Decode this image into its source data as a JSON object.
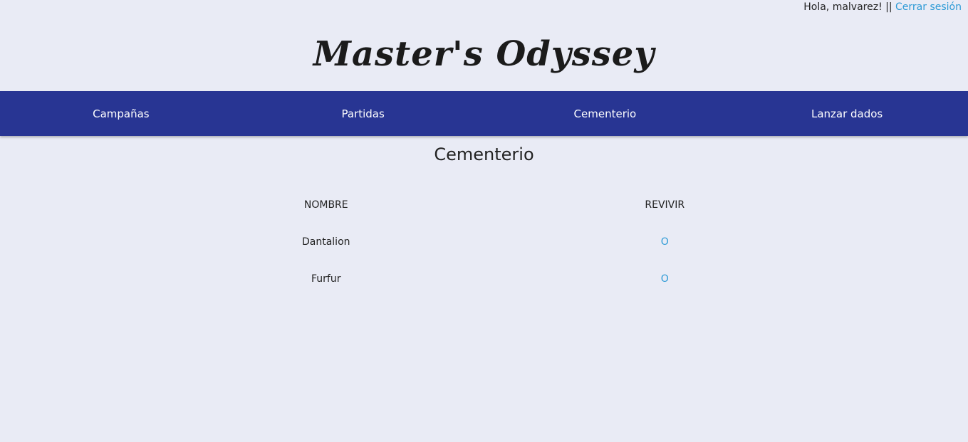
{
  "user_bar": {
    "greeting": "Hola, malvarez! ||",
    "logout_label": "Cerrar sesión",
    "link_color": "#2e9bd6"
  },
  "brand": {
    "title": "Master's Odyssey"
  },
  "nav": {
    "background": "#283593",
    "items": [
      {
        "label": "Campañas"
      },
      {
        "label": "Partidas"
      },
      {
        "label": "Cementerio"
      },
      {
        "label": "Lanzar dados"
      }
    ]
  },
  "page": {
    "title": "Cementerio"
  },
  "table": {
    "headers": {
      "name": "NOMBRE",
      "revive": "REVIVIR"
    },
    "rows": [
      {
        "name": "Dantalion",
        "revive": "O"
      },
      {
        "name": "Furfur",
        "revive": "O"
      }
    ]
  }
}
